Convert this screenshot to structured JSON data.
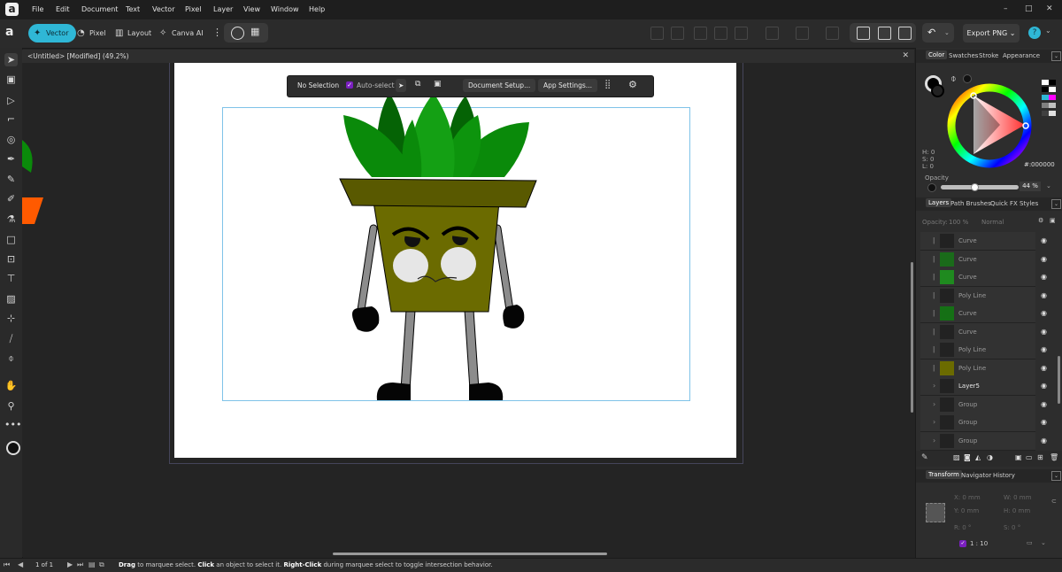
{
  "app": {
    "logo_letter": "a",
    "menu": [
      "File",
      "Edit",
      "Document",
      "Text",
      "Vector",
      "Pixel",
      "Layer",
      "View",
      "Window",
      "Help"
    ],
    "window_controls": [
      "–",
      "□",
      "✕"
    ]
  },
  "toolbar": {
    "personas": [
      {
        "label": "Vector",
        "icon": "vector-persona-icon",
        "active": true
      },
      {
        "label": "Pixel",
        "icon": "pixel-persona-icon",
        "active": false
      },
      {
        "label": "Layout",
        "icon": "layout-persona-icon",
        "active": false
      },
      {
        "label": "Canva AI",
        "icon": "sparkle-icon",
        "active": false
      }
    ],
    "export_label": "Export PNG",
    "accent": "#2fb7d6"
  },
  "document": {
    "tab_title": "<Untitled> [Modified] (49.2%)"
  },
  "context_toolbar": {
    "selection": "No Selection",
    "auto_select": "Auto-select",
    "auto_select_checked": true,
    "document_setup": "Document Setup...",
    "app_settings": "App Settings..."
  },
  "color_panel": {
    "tabs": [
      "Color",
      "Swatches",
      "Stroke",
      "Appearance"
    ],
    "h": "H: 0",
    "s": "S: 0",
    "l": "L: 0",
    "hex": "000000",
    "opacity_label": "Opacity",
    "opacity_value": "44 %",
    "swatches": [
      "#ffffff",
      "#000000",
      "#2fb7d6",
      "#ff00ff",
      "#808080",
      "#c0c0c0",
      "#404040",
      "#e0e0e0"
    ]
  },
  "layers_panel": {
    "tabs": [
      "Layers",
      "Path Brushes",
      "Quick FX",
      "Styles"
    ],
    "opacity_label": "Opacity:",
    "opacity_value": "100 %",
    "blend": "Normal",
    "rows": [
      {
        "name": "Curve",
        "bright": false,
        "thumb": "#222222"
      },
      {
        "name": "Curve",
        "bright": false,
        "thumb": "#1a6b1a"
      },
      {
        "name": "Curve",
        "bright": false,
        "thumb": "#1f8a1f"
      },
      {
        "name": "Poly Line",
        "bright": false,
        "thumb": "#222222"
      },
      {
        "name": "Curve",
        "bright": false,
        "thumb": "#157015"
      },
      {
        "name": "Curve",
        "bright": false,
        "thumb": "#222222"
      },
      {
        "name": "Poly Line",
        "bright": false,
        "thumb": "#222222"
      },
      {
        "name": "Poly Line",
        "bright": false,
        "thumb": "#6b6b00"
      },
      {
        "name": "Layer5",
        "bright": true,
        "thumb": "#222222"
      },
      {
        "name": "Group",
        "bright": false,
        "thumb": "#222222"
      },
      {
        "name": "Group",
        "bright": false,
        "thumb": "#222222"
      },
      {
        "name": "Group",
        "bright": false,
        "thumb": "#222222"
      }
    ]
  },
  "transform_panel": {
    "tabs": [
      "Transform",
      "Navigator",
      "History"
    ],
    "x": "X: 0 mm",
    "y": "Y: 0 mm",
    "w": "W: 0 mm",
    "h": "H: 0 mm",
    "r": "R: 0 °",
    "s": "S: 0 °",
    "ratio": "1 : 10"
  },
  "status": {
    "page": "1 of 1",
    "hint_drag": "Drag",
    "hint_1": " to marquee select. ",
    "hint_click": "Click",
    "hint_2": " an object to select it. ",
    "hint_rclick": "Right-Click",
    "hint_3": " during marquee select to toggle intersection behavior."
  },
  "artwork_colors": {
    "leaf_dark": "#056305",
    "leaf": "#0a8a0a",
    "leaf_light": "#14a014",
    "pot_rim": "#595900",
    "pot_body": "#6b6b00",
    "limb": "#8c8c8c",
    "shoe": "#050505"
  }
}
